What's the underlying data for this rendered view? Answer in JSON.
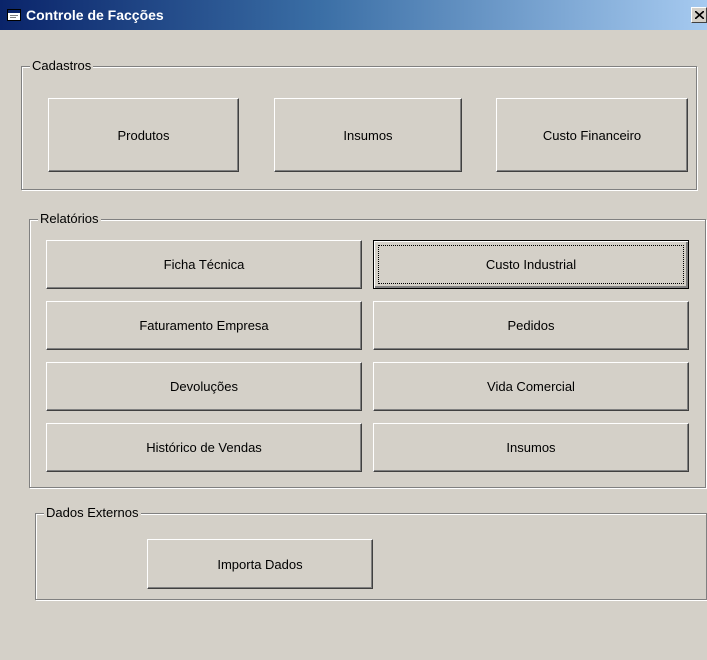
{
  "window": {
    "title": "Controle de Facções",
    "close_symbol": "✕",
    "icon": "form-icon"
  },
  "cadastros": {
    "legend": "Cadastros",
    "buttons": [
      "Produtos",
      "Insumos",
      "Custo Financeiro"
    ]
  },
  "relatorios": {
    "legend": "Relatórios",
    "buttons": [
      "Ficha Técnica",
      "Custo Industrial",
      "Faturamento Empresa",
      "Pedidos",
      "Devoluções",
      "Vida Comercial",
      "Histórico de Vendas",
      "Insumos"
    ],
    "default_button": "Custo Industrial"
  },
  "dados_externos": {
    "legend": "Dados Externos",
    "buttons": [
      "Importa Dados"
    ]
  },
  "colors": {
    "face": "#d4d0c8",
    "title_start": "#0a246a",
    "title_end": "#a6caf0"
  }
}
